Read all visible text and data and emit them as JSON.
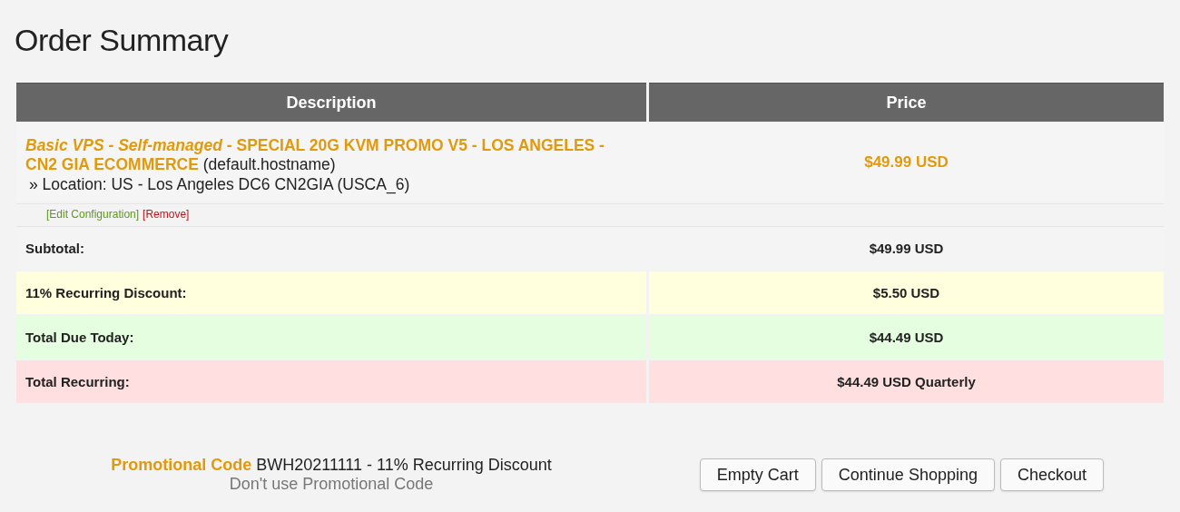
{
  "page_title": "Order Summary",
  "table": {
    "columns": [
      "Description",
      "Price"
    ],
    "item": {
      "group": "Basic VPS - Self-managed",
      "name": "- SPECIAL 20G KVM PROMO V5 - LOS ANGELES - CN2 GIA ECOMMERCE",
      "hostname": "(default.hostname)",
      "option": "» Location: US - Los Angeles DC6 CN2GIA (USCA_6)",
      "price": "$49.99 USD",
      "edit_link": "[Edit Configuration]",
      "remove_link": "[Remove]"
    },
    "summary_rows": [
      {
        "kind": "subtotal",
        "label": "Subtotal:",
        "value": "$49.99 USD"
      },
      {
        "kind": "discount",
        "label": "11% Recurring Discount:",
        "value": "$5.50 USD"
      },
      {
        "kind": "total",
        "label": "Total Due Today:",
        "value": "$44.49 USD"
      },
      {
        "kind": "recurring",
        "label": "Total Recurring:",
        "value": "$44.49 USD Quarterly"
      }
    ]
  },
  "promo": {
    "label": "Promotional Code",
    "code": "BWH20211111 - 11% Recurring Discount",
    "remove_link": "Don't use Promotional Code"
  },
  "buttons": [
    "Empty Cart",
    "Continue Shopping",
    "Checkout"
  ]
}
